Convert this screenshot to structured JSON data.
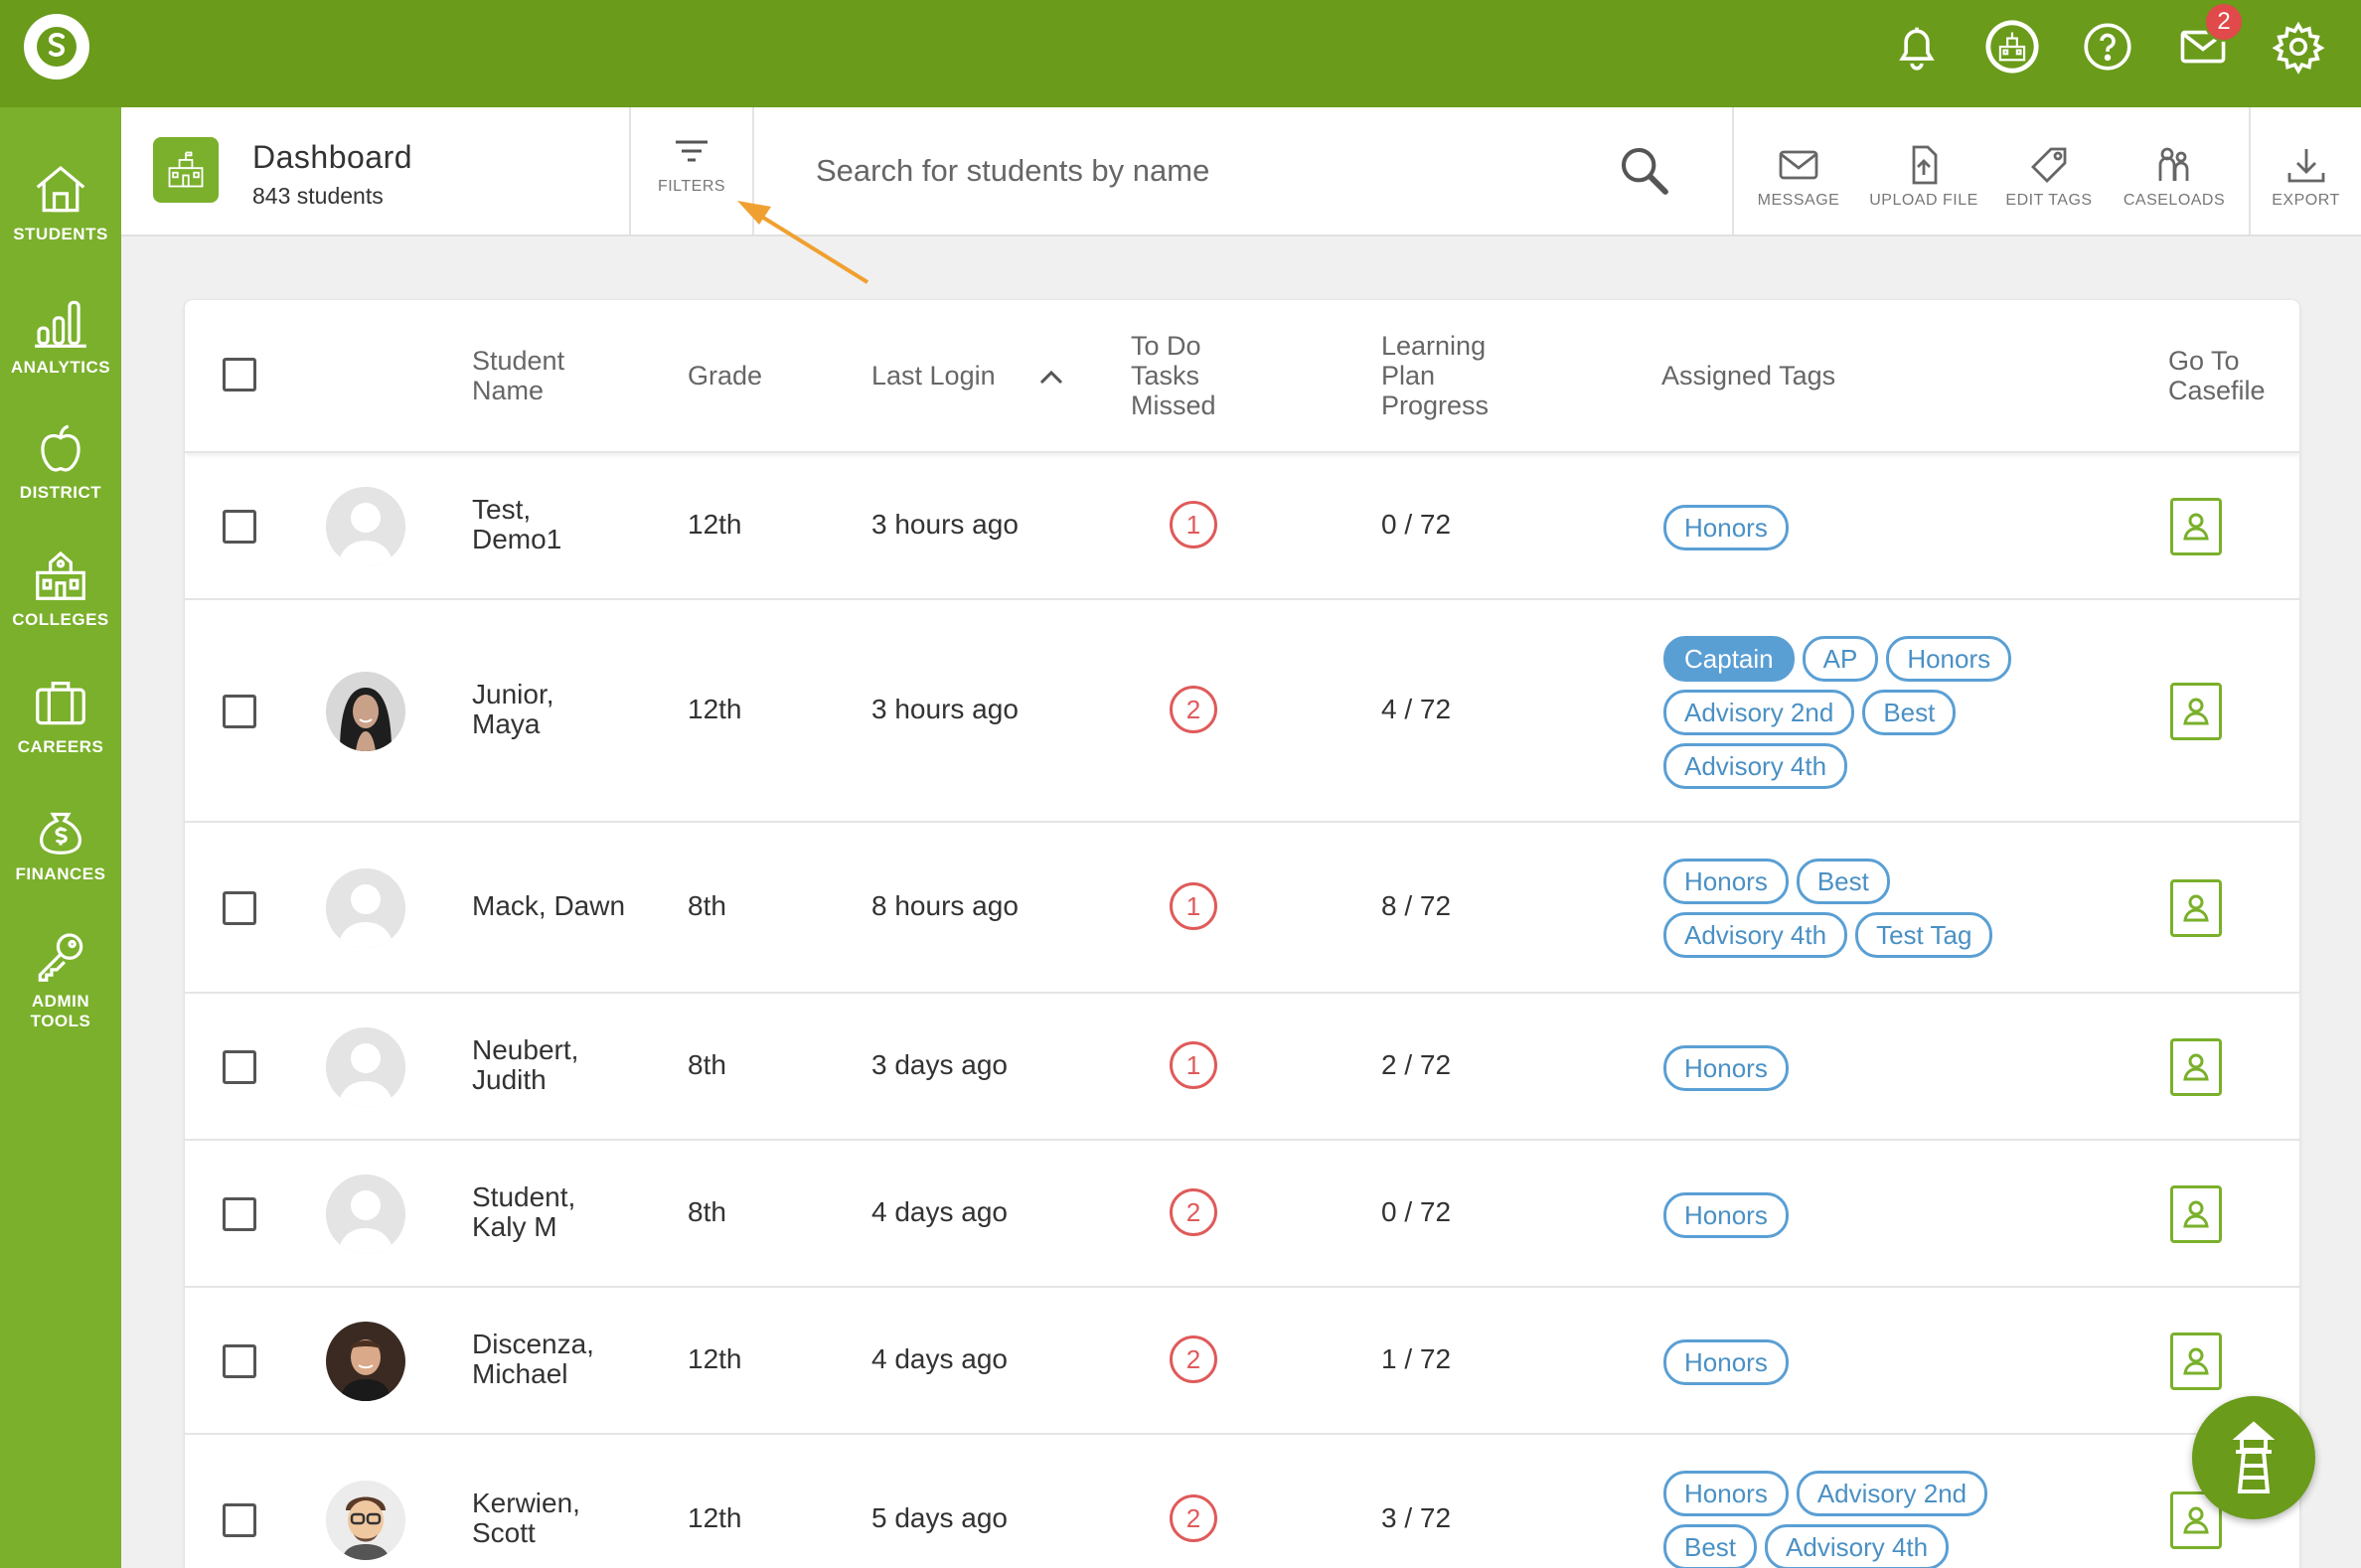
{
  "header": {
    "notification_count": "2",
    "icons": [
      "logo-icon",
      "bell-icon",
      "school-icon",
      "help-icon",
      "mail-icon",
      "gear-icon"
    ]
  },
  "sidebar": {
    "items": [
      {
        "label": "STUDENTS",
        "icon": "home-icon"
      },
      {
        "label": "ANALYTICS",
        "icon": "bar-chart-icon"
      },
      {
        "label": "DISTRICT",
        "icon": "apple-icon"
      },
      {
        "label": "COLLEGES",
        "icon": "college-icon"
      },
      {
        "label": "CAREERS",
        "icon": "briefcase-icon"
      },
      {
        "label": "FINANCES",
        "icon": "money-bag-icon"
      },
      {
        "label": "ADMIN\nTOOLS",
        "icon": "key-icon"
      }
    ]
  },
  "toolbar": {
    "title": "Dashboard",
    "subtitle": "843 students",
    "filters_label": "FILTERS",
    "search_placeholder": "Search for students by name",
    "actions": [
      {
        "label": "MESSAGE",
        "icon": "envelope-icon"
      },
      {
        "label": "UPLOAD FILE",
        "icon": "upload-file-icon"
      },
      {
        "label": "EDIT TAGS",
        "icon": "tag-icon"
      },
      {
        "label": "CASELOADS",
        "icon": "people-icon"
      },
      {
        "label": "EXPORT",
        "icon": "download-icon"
      }
    ]
  },
  "table": {
    "columns": {
      "name": "Student\nName",
      "grade": "Grade",
      "last_login": "Last Login",
      "tasks": "To Do\nTasks\nMissed",
      "progress": "Learning\nPlan\nProgress",
      "tags": "Assigned Tags",
      "casefile": "Go To\nCasefile"
    },
    "sort": {
      "column": "Last Login",
      "direction": "ascending"
    },
    "rows": [
      {
        "name": "Test,\nDemo1",
        "grade": "12th",
        "last_login": "3 hours ago",
        "tasks_missed": "1",
        "progress": "0 / 72",
        "avatar": "placeholder",
        "tags": [
          {
            "label": "Honors",
            "active": false
          }
        ]
      },
      {
        "name": "Junior,\nMaya",
        "grade": "12th",
        "last_login": "3 hours ago",
        "tasks_missed": "2",
        "progress": "4 / 72",
        "avatar": "photo",
        "tags": [
          {
            "label": "Captain",
            "active": true
          },
          {
            "label": "AP",
            "active": false
          },
          {
            "label": "Honors",
            "active": false
          },
          {
            "label": "Advisory 2nd",
            "active": false
          },
          {
            "label": "Best",
            "active": false
          },
          {
            "label": "Advisory 4th",
            "active": false
          }
        ]
      },
      {
        "name": "Mack, Dawn",
        "grade": "8th",
        "last_login": "8 hours ago",
        "tasks_missed": "1",
        "progress": "8 / 72",
        "avatar": "placeholder",
        "tags": [
          {
            "label": "Honors",
            "active": false
          },
          {
            "label": "Best",
            "active": false
          },
          {
            "label": "Advisory 4th",
            "active": false
          },
          {
            "label": "Test Tag",
            "active": false
          }
        ]
      },
      {
        "name": "Neubert,\nJudith",
        "grade": "8th",
        "last_login": "3 days ago",
        "tasks_missed": "1",
        "progress": "2 / 72",
        "avatar": "placeholder",
        "tags": [
          {
            "label": "Honors",
            "active": false
          }
        ]
      },
      {
        "name": "Student,\nKaly M",
        "grade": "8th",
        "last_login": "4 days ago",
        "tasks_missed": "2",
        "progress": "0 / 72",
        "avatar": "placeholder",
        "tags": [
          {
            "label": "Honors",
            "active": false
          }
        ]
      },
      {
        "name": "Discenza,\nMichael",
        "grade": "12th",
        "last_login": "4 days ago",
        "tasks_missed": "2",
        "progress": "1 / 72",
        "avatar": "photo",
        "tags": [
          {
            "label": "Honors",
            "active": false
          }
        ]
      },
      {
        "name": "Kerwien,\nScott",
        "grade": "12th",
        "last_login": "5 days ago",
        "tasks_missed": "2",
        "progress": "3 / 72",
        "avatar": "cartoon",
        "tags": [
          {
            "label": "Honors",
            "active": false
          },
          {
            "label": "Advisory 2nd",
            "active": false
          },
          {
            "label": "Best",
            "active": false
          },
          {
            "label": "Advisory 4th",
            "active": false
          }
        ]
      }
    ]
  },
  "colors": {
    "topbar": "#6a9b1a",
    "sidebar": "#7ab02b",
    "tag": "#5a9fd4",
    "alert": "#e05a5a",
    "annotation_arrow": "#f0a030"
  },
  "fab_icon": "lighthouse-icon"
}
